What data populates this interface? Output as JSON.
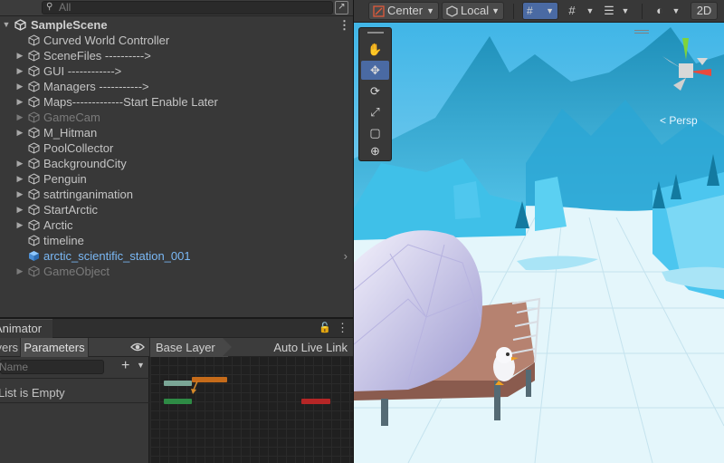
{
  "hierarchy": {
    "search_placeholder": "All",
    "scene_name": "SampleScene",
    "items": [
      {
        "label": "Curved World Controller"
      },
      {
        "label": "SceneFiles ---------->"
      },
      {
        "label": "GUI ------------>"
      },
      {
        "label": "Managers ----------->"
      },
      {
        "label": "Maps-------------Start Enable Later"
      },
      {
        "label": "GameCam"
      },
      {
        "label": "M_Hitman"
      },
      {
        "label": "PoolCollector"
      },
      {
        "label": "BackgroundCity"
      },
      {
        "label": "Penguin"
      },
      {
        "label": "satrtinganimation"
      },
      {
        "label": "StartArctic"
      },
      {
        "label": "Arctic"
      },
      {
        "label": "timeline"
      },
      {
        "label": "arctic_scientific_station_001"
      },
      {
        "label": "GameObject"
      }
    ]
  },
  "animator": {
    "tab_label": "Animator",
    "layers_tab": "Layers",
    "parameters_tab": "Parameters",
    "search_placeholder": "Name",
    "list_empty": "List is Empty",
    "base_layer": "Base Layer",
    "auto_live_link": "Auto Live Link",
    "colors": {
      "entry": "#7aa696",
      "default_state": "#c56b1a",
      "any": "#2e8b45",
      "exit": "#b52626"
    }
  },
  "scene_toolbar": {
    "pivot": "Center",
    "space": "Local",
    "mode_2d": "2D"
  },
  "scene": {
    "camera_label": "Persp",
    "sky_color": "#3ab3e6",
    "ice_color": "#e4f6fb"
  }
}
